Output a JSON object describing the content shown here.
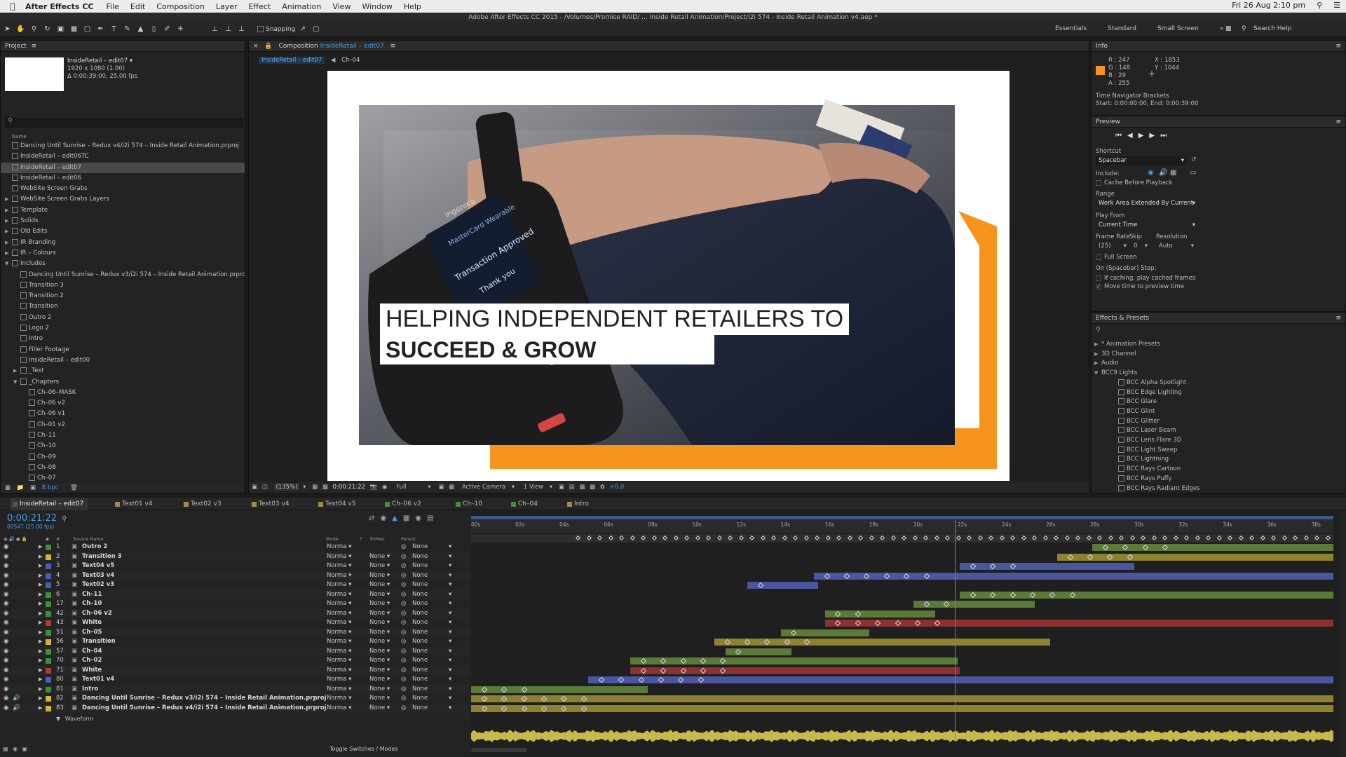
{
  "menubar": {
    "app": "After Effects CC",
    "items": [
      "File",
      "Edit",
      "Composition",
      "Layer",
      "Effect",
      "Animation",
      "View",
      "Window",
      "Help"
    ],
    "datetime": "Fri 26 Aug  2:10 pm"
  },
  "title": "Adobe After Effects CC 2015 - /Volumes/Promise RAID/ ... Inside Retail Animation/Project/i2i 574 - Inside Retail Animation v4.aep *",
  "toolbar": {
    "snapping": "Snapping",
    "workspaces": [
      "Essentials",
      "Standard",
      "Small Screen"
    ],
    "search": "Search Help"
  },
  "project": {
    "title": "Project",
    "comp_name": "InsideRetail – edit07 ▾",
    "comp_size": "1920 x 1080 (1.00)",
    "comp_dur": "Δ 0:00:39:00, 25.00 fps",
    "col_name": "Name",
    "bpc": "8 bpc",
    "items": [
      {
        "label": "Dancing Until Sunrise – Redux v4/i2i 574 – Inside Retail Animation.prproj",
        "ind": 0,
        "t": ""
      },
      {
        "label": "InsideRetail – edit06TC",
        "ind": 0,
        "t": ""
      },
      {
        "label": "InsideRetail – edit07",
        "ind": 0,
        "t": "",
        "sel": true
      },
      {
        "label": "InsideRetail – edit06",
        "ind": 0,
        "t": ""
      },
      {
        "label": "WebSite Screen Grabs",
        "ind": 0,
        "t": ""
      },
      {
        "label": "WebSite Screen Grabs Layers",
        "ind": 0,
        "t": "▶"
      },
      {
        "label": "Template",
        "ind": 0,
        "t": "▶"
      },
      {
        "label": "Solids",
        "ind": 0,
        "t": "▶"
      },
      {
        "label": "Old Edits",
        "ind": 0,
        "t": "▶"
      },
      {
        "label": "IR Branding",
        "ind": 0,
        "t": "▶"
      },
      {
        "label": "IR – Colours",
        "ind": 0,
        "t": "▶"
      },
      {
        "label": "Includes",
        "ind": 0,
        "t": "▼"
      },
      {
        "label": "Dancing Until Sunrise – Redux v3/i2i 574 – Inside Retail Animation.prproj",
        "ind": 1,
        "t": ""
      },
      {
        "label": "Transition 3",
        "ind": 1,
        "t": ""
      },
      {
        "label": "Transition 2",
        "ind": 1,
        "t": ""
      },
      {
        "label": "Transition",
        "ind": 1,
        "t": ""
      },
      {
        "label": "Outro 2",
        "ind": 1,
        "t": ""
      },
      {
        "label": "Logo 2",
        "ind": 1,
        "t": ""
      },
      {
        "label": "Intro",
        "ind": 1,
        "t": ""
      },
      {
        "label": "Filler Footage",
        "ind": 1,
        "t": ""
      },
      {
        "label": "InsideRetail – edit00",
        "ind": 1,
        "t": ""
      },
      {
        "label": "_Text",
        "ind": 1,
        "t": "▶"
      },
      {
        "label": "_Chapters",
        "ind": 1,
        "t": "▼"
      },
      {
        "label": "Ch–06–MASK",
        "ind": 2,
        "t": ""
      },
      {
        "label": "Ch–06 v2",
        "ind": 2,
        "t": ""
      },
      {
        "label": "Ch–06 v1",
        "ind": 2,
        "t": ""
      },
      {
        "label": "Ch–01 v2",
        "ind": 2,
        "t": ""
      },
      {
        "label": "Ch–11",
        "ind": 2,
        "t": ""
      },
      {
        "label": "Ch–10",
        "ind": 2,
        "t": ""
      },
      {
        "label": "Ch–09",
        "ind": 2,
        "t": ""
      },
      {
        "label": "Ch–08",
        "ind": 2,
        "t": ""
      },
      {
        "label": "Ch–07",
        "ind": 2,
        "t": ""
      }
    ]
  },
  "composition": {
    "tab_prefix": "Composition",
    "tab_name": "InsideRetail – edit07",
    "crumb1": "InsideRetail – edit07",
    "crumb2": "Ch–04",
    "zoom": "(135%)",
    "time": "0:00:21:22",
    "res": "Full",
    "camera": "Active Camera",
    "views": "1 View",
    "exposure": "+0.0"
  },
  "canvas": {
    "line1": "HELPING INDEPENDENT RETAILERS TO",
    "line2": "SUCCEED & GROW",
    "terminal_brand": "ingenico",
    "terminal_text1": "MasterCard Wearable",
    "terminal_text2": "Transaction Approved",
    "terminal_text3": "Thank you",
    "terminal_model": "iWL250"
  },
  "info": {
    "title": "Info",
    "r": "R : 247",
    "g": "G : 148",
    "b": "B : 29",
    "a": "A : 255",
    "x": "X : 1853",
    "y": "Y : 1044",
    "nav_title": "Time Navigator Brackets",
    "nav_range": "Start: 0:00:00:00, End: 0:00:39:00",
    "swatch": "#f7941d"
  },
  "preview": {
    "title": "Preview",
    "shortcut_label": "Shortcut",
    "shortcut": "Spacebar",
    "include": "Include:",
    "cache": "Cache Before Playback",
    "range_label": "Range",
    "range": "Work Area Extended By Current",
    "playfrom_label": "Play From",
    "playfrom": "Current Time",
    "fr_label": "Frame Rate",
    "skip_label": "Skip",
    "res_label": "Resolution",
    "fr": "(25)",
    "skip": "0",
    "res": "Auto",
    "fullscreen": "Full Screen",
    "stop_label": "On (Spacebar) Stop:",
    "opt1": "If caching, play cached frames",
    "opt2": "Move time to preview time"
  },
  "effects": {
    "title": "Effects & Presets",
    "items": [
      {
        "label": "* Animation Presets",
        "ind": 0,
        "t": "▶"
      },
      {
        "label": "3D Channel",
        "ind": 0,
        "t": "▶"
      },
      {
        "label": "Audio",
        "ind": 0,
        "t": "▶"
      },
      {
        "label": "BCC9 Lights",
        "ind": 0,
        "t": "▼"
      },
      {
        "label": "BCC Alpha Spotlight",
        "ind": 1
      },
      {
        "label": "BCC Edge Lighting",
        "ind": 1
      },
      {
        "label": "BCC Glare",
        "ind": 1
      },
      {
        "label": "BCC Glint",
        "ind": 1
      },
      {
        "label": "BCC Glitter",
        "ind": 1
      },
      {
        "label": "BCC Laser Beam",
        "ind": 1
      },
      {
        "label": "BCC Lens Flare 3D",
        "ind": 1
      },
      {
        "label": "BCC Light Sweep",
        "ind": 1
      },
      {
        "label": "BCC Lightning",
        "ind": 1
      },
      {
        "label": "BCC Rays Cartoon",
        "ind": 1
      },
      {
        "label": "BCC Rays Puffy",
        "ind": 1
      },
      {
        "label": "BCC Rays Radiant Edges",
        "ind": 1
      }
    ]
  },
  "timeline": {
    "tabs": [
      {
        "label": "InsideRetail – edit07",
        "color": "#555"
      },
      {
        "label": "Text01 v4",
        "color": "#a38c4a"
      },
      {
        "label": "Text02 v3",
        "color": "#a38c4a"
      },
      {
        "label": "Text03 v4",
        "color": "#a38c4a"
      },
      {
        "label": "Text04 v5",
        "color": "#a38c4a"
      },
      {
        "label": "Ch–06 v2",
        "color": "#4a8c3a"
      },
      {
        "label": "Ch–10",
        "color": "#4a8c3a"
      },
      {
        "label": "Ch–04",
        "color": "#4a8c3a"
      },
      {
        "label": "Intro",
        "color": "#a38c4a"
      }
    ],
    "timecode": "0:00:21:22",
    "frames": "00547 (25.00 fps)",
    "headers": {
      "source": "Source Name",
      "mode": "Mode",
      "t": "T",
      "trkmat": "TrkMat",
      "parent": "Parent"
    },
    "ruler": [
      "00s",
      "02s",
      "04s",
      "06s",
      "08s",
      "10s",
      "12s",
      "14s",
      "16s",
      "18s",
      "20s",
      "22s",
      "24s",
      "26s",
      "28s",
      "30s",
      "32s",
      "34s",
      "36s",
      "38s"
    ],
    "toggle": "Toggle Switches / Modes",
    "waveform": "Waveform",
    "layers": [
      {
        "num": "1",
        "name": "Outro 2",
        "mode": "Norma",
        "trk": "",
        "parent": "None",
        "color": "#3f8f3a"
      },
      {
        "num": "2",
        "name": "Transition 3",
        "mode": "Norma",
        "trk": "None",
        "parent": "None",
        "color": "#d3b33a"
      },
      {
        "num": "3",
        "name": "Text04 v5",
        "mode": "Norma",
        "trk": "None",
        "parent": "None",
        "color": "#4a5fb3"
      },
      {
        "num": "4",
        "name": "Text03 v4",
        "mode": "Norma",
        "trk": "None",
        "parent": "None",
        "color": "#4a5fb3"
      },
      {
        "num": "5",
        "name": "Text02 v3",
        "mode": "Norma",
        "trk": "None",
        "parent": "None",
        "color": "#4a5fb3"
      },
      {
        "num": "6",
        "name": "Ch–11",
        "mode": "Norma",
        "trk": "None",
        "parent": "None",
        "color": "#3f8f3a"
      },
      {
        "num": "17",
        "name": "Ch–10",
        "mode": "Norma",
        "trk": "None",
        "parent": "None",
        "color": "#3f8f3a"
      },
      {
        "num": "42",
        "name": "Ch–06 v2",
        "mode": "Norma",
        "trk": "None",
        "parent": "None",
        "color": "#3f8f3a"
      },
      {
        "num": "43",
        "name": "White",
        "mode": "Norma",
        "trk": "None",
        "parent": "None",
        "color": "#b33a3a"
      },
      {
        "num": "51",
        "name": "Ch–05",
        "mode": "Norma",
        "trk": "None",
        "parent": "None",
        "color": "#3f8f3a"
      },
      {
        "num": "56",
        "name": "Transition",
        "mode": "Norma",
        "trk": "None",
        "parent": "None",
        "color": "#d3b33a"
      },
      {
        "num": "57",
        "name": "Ch–04",
        "mode": "Norma",
        "trk": "None",
        "parent": "None",
        "color": "#3f8f3a"
      },
      {
        "num": "70",
        "name": "Ch–02",
        "mode": "Norma",
        "trk": "None",
        "parent": "None",
        "color": "#3f8f3a"
      },
      {
        "num": "71",
        "name": "White",
        "mode": "Norma",
        "trk": "None",
        "parent": "None",
        "color": "#b33a3a"
      },
      {
        "num": "80",
        "name": "Text01 v4",
        "mode": "Norma",
        "trk": "None",
        "parent": "None",
        "color": "#4a5fb3"
      },
      {
        "num": "81",
        "name": "Intro",
        "mode": "Norma",
        "trk": "None",
        "parent": "None",
        "color": "#3f8f3a"
      },
      {
        "num": "82",
        "name": "Dancing Until Sunrise – Redux v3/i2i 574 – Inside Retail Animation.prproj",
        "mode": "Norma",
        "trk": "None",
        "parent": "None",
        "color": "#d3b33a"
      },
      {
        "num": "83",
        "name": "Dancing Until Sunrise – Redux v4/i2i 574 – Inside Retail Animation.prproj",
        "mode": "Norma",
        "trk": "None",
        "parent": "None",
        "color": "#d3b33a"
      }
    ],
    "bars": [
      {
        "s": 28.1,
        "e": 39,
        "c": "#5b7a3a"
      },
      {
        "s": 26.5,
        "e": 39,
        "c": "#8c8230"
      },
      {
        "s": 22.1,
        "e": 30,
        "c": "#4a56a0"
      },
      {
        "s": 15.5,
        "e": 39,
        "c": "#4a56a0"
      },
      {
        "s": 12.5,
        "e": 15.7,
        "c": "#4a56a0"
      },
      {
        "s": 22.1,
        "e": 39,
        "c": "#5b7a3a"
      },
      {
        "s": 20,
        "e": 25.5,
        "c": "#5b7a3a"
      },
      {
        "s": 16,
        "e": 21,
        "c": "#5b7a3a"
      },
      {
        "s": 16,
        "e": 39,
        "c": "#8c3030"
      },
      {
        "s": 14,
        "e": 18,
        "c": "#5b7a3a"
      },
      {
        "s": 11,
        "e": 26.2,
        "c": "#8c8230"
      },
      {
        "s": 11.5,
        "e": 14.5,
        "c": "#5b7a3a"
      },
      {
        "s": 7.2,
        "e": 22,
        "c": "#5b7a3a"
      },
      {
        "s": 7.2,
        "e": 22.1,
        "c": "#8c3030"
      },
      {
        "s": 5.3,
        "e": 39,
        "c": "#4a56a0"
      },
      {
        "s": 0,
        "e": 8,
        "c": "#5b7a3a"
      },
      {
        "s": 0,
        "e": 39,
        "c": "#8c8230"
      },
      {
        "s": 0,
        "e": 39,
        "c": "#8c8230"
      }
    ],
    "playhead": 21.88,
    "duration": 39
  }
}
